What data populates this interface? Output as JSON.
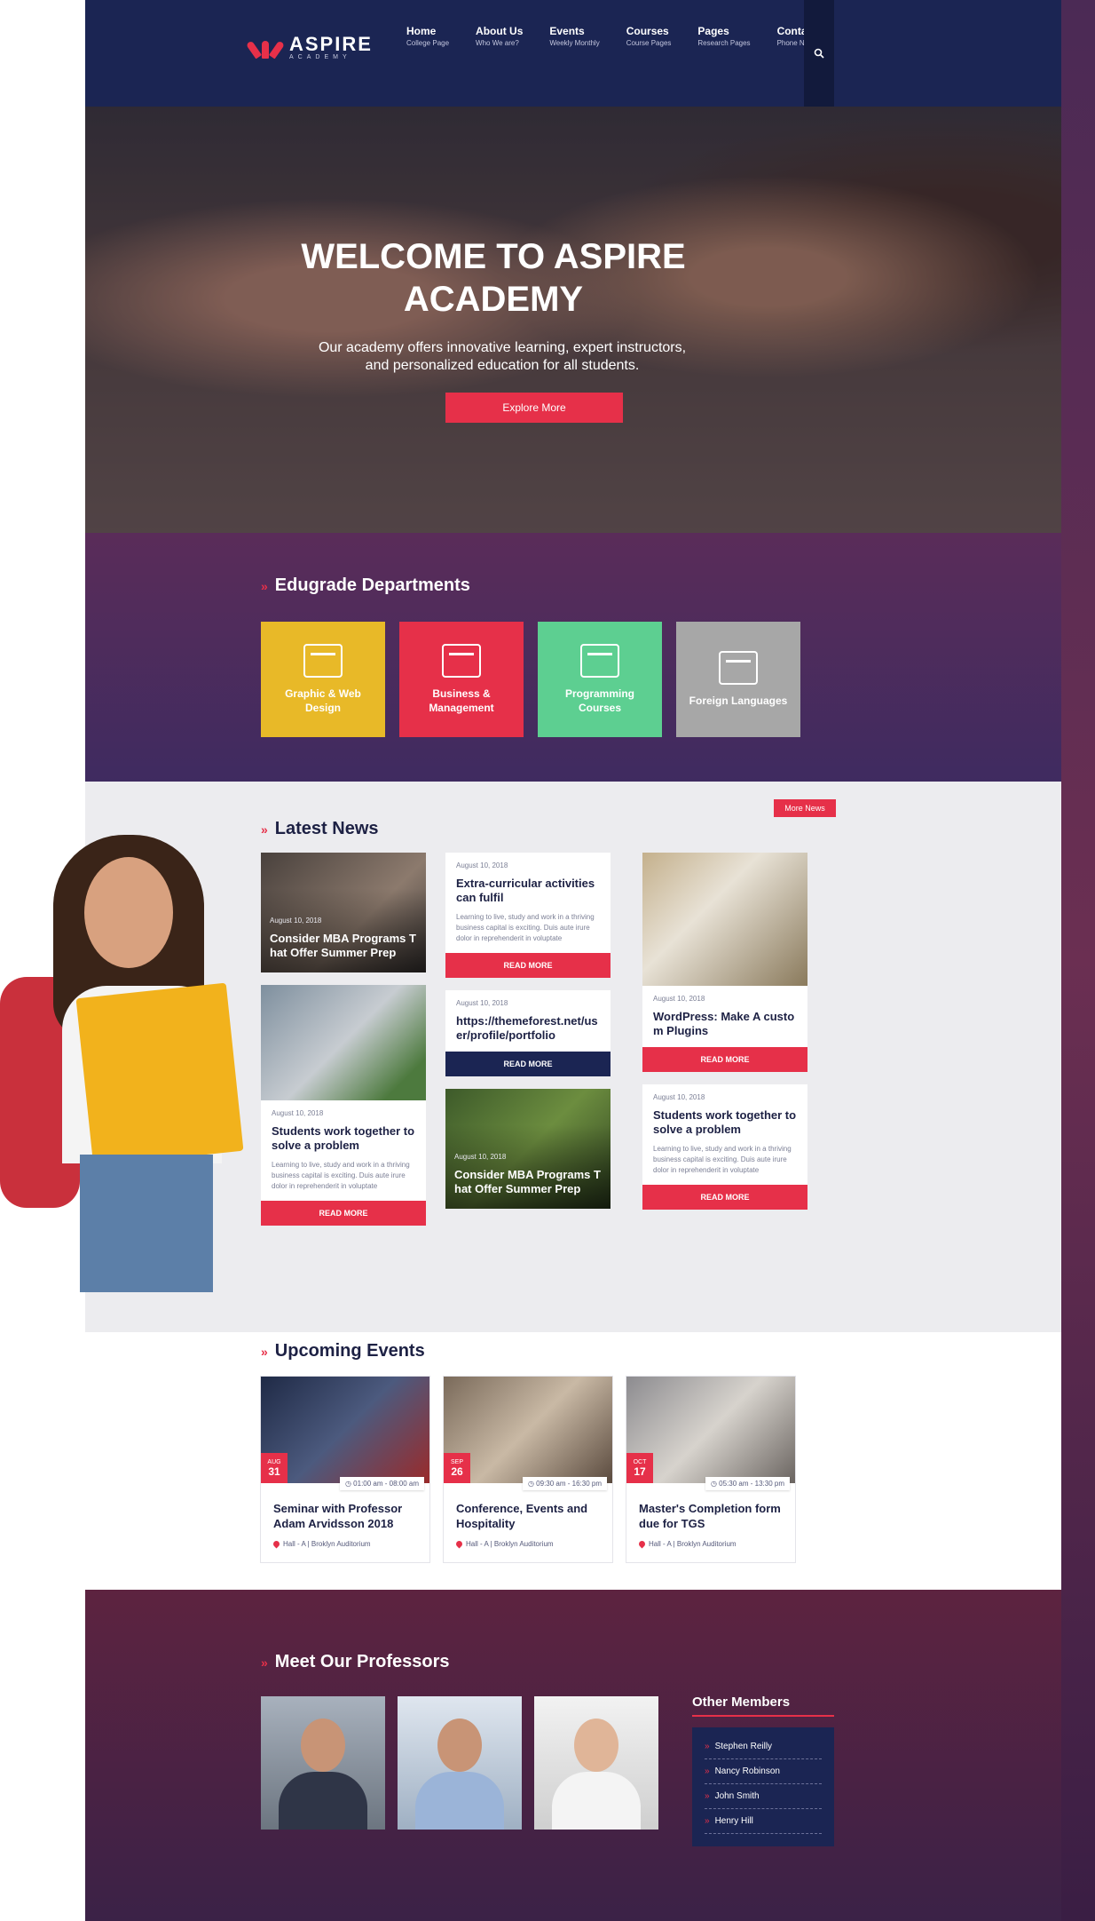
{
  "brand": {
    "name": "ASPIRE",
    "tagline": "ACADEMY"
  },
  "nav": [
    {
      "label": "Home",
      "sub": "College Page"
    },
    {
      "label": "About Us",
      "sub": "Who We are?"
    },
    {
      "label": "Events",
      "sub": "Weekly Monthly"
    },
    {
      "label": "Courses",
      "sub": "Course Pages"
    },
    {
      "label": "Pages",
      "sub": "Research Pages"
    },
    {
      "label": "Contact",
      "sub": "Phone Numbers"
    }
  ],
  "hero": {
    "title": "WELCOME TO ASPIRE ACADEMY",
    "text": "Our academy offers innovative learning, expert instructors, and personalized education for all students.",
    "button": "Explore More"
  },
  "departments": {
    "title": "Edugrade Departments",
    "items": [
      {
        "label": "Graphic & Web Design",
        "color": "#e8b928"
      },
      {
        "label": "Business & Management",
        "color": "#e63049"
      },
      {
        "label": "Programming Courses",
        "color": "#5dcf91"
      },
      {
        "label": "Foreign Languages",
        "color": "#a7a7a7"
      }
    ]
  },
  "news": {
    "title": "Latest News",
    "more": "More News",
    "read_more": "READ MORE",
    "cards": [
      {
        "date": "August 10, 2018",
        "title": "Consider MBA Programs That Offer Summer Prep"
      },
      {
        "date": "August 10, 2018",
        "title": "Students work together to solve a problem",
        "text": "Learning to live, study and work in a thriving business capital is exciting. Duis aute irure dolor in reprehenderit in voluptate"
      },
      {
        "date": "August 10, 2018",
        "title": "Extra-curricular activities can fulfil",
        "text": "Learning to live, study and work in a thriving business capital is exciting. Duis aute irure dolor in reprehenderit in voluptate"
      },
      {
        "date": "August 10, 2018",
        "title": "https://themeforest.net/user/profile/portfolio"
      },
      {
        "date": "August 10, 2018",
        "title": "Consider MBA Programs That Offer Summer Prep"
      },
      {
        "date": "August 10, 2018",
        "title": "WordPress: Make A custom Plugins"
      },
      {
        "date": "August 10, 2018",
        "title": "Students work together to solve a problem",
        "text": "Learning to live, study and work in a thriving business capital is exciting. Duis aute irure dolor in reprehenderit in voluptate"
      }
    ]
  },
  "events": {
    "title": "Upcoming Events",
    "items": [
      {
        "month": "AUG",
        "day": "31",
        "time": "01:00 am - 08:00 am",
        "title": "Seminar with Professor Adam Arvidsson 2018",
        "location": "Hall - A | Broklyn Auditorium"
      },
      {
        "month": "SEP",
        "day": "26",
        "time": "09:30 am - 16:30 pm",
        "title": "Conference, Events and Hospitality",
        "location": "Hall - A | Broklyn Auditorium"
      },
      {
        "month": "OCT",
        "day": "17",
        "time": "05:30 am - 13:30 pm",
        "title": "Master's Completion form due for TGS",
        "location": "Hall - A | Broklyn Auditorium"
      }
    ]
  },
  "professors": {
    "title": "Meet Our Professors",
    "others_title": "Other Members",
    "others": [
      "Stephen Reilly",
      "Nancy Robinson",
      "John Smith",
      "Henry Hill"
    ]
  },
  "icons": {
    "search": "search-icon",
    "calendar": "calendar-icon",
    "clock": "clock-icon",
    "pin": "map-pin-icon",
    "arrow": "double-arrow-icon"
  },
  "colors": {
    "accent": "#e63049",
    "navy": "#1b2553",
    "purple": "#4f2b5c"
  }
}
